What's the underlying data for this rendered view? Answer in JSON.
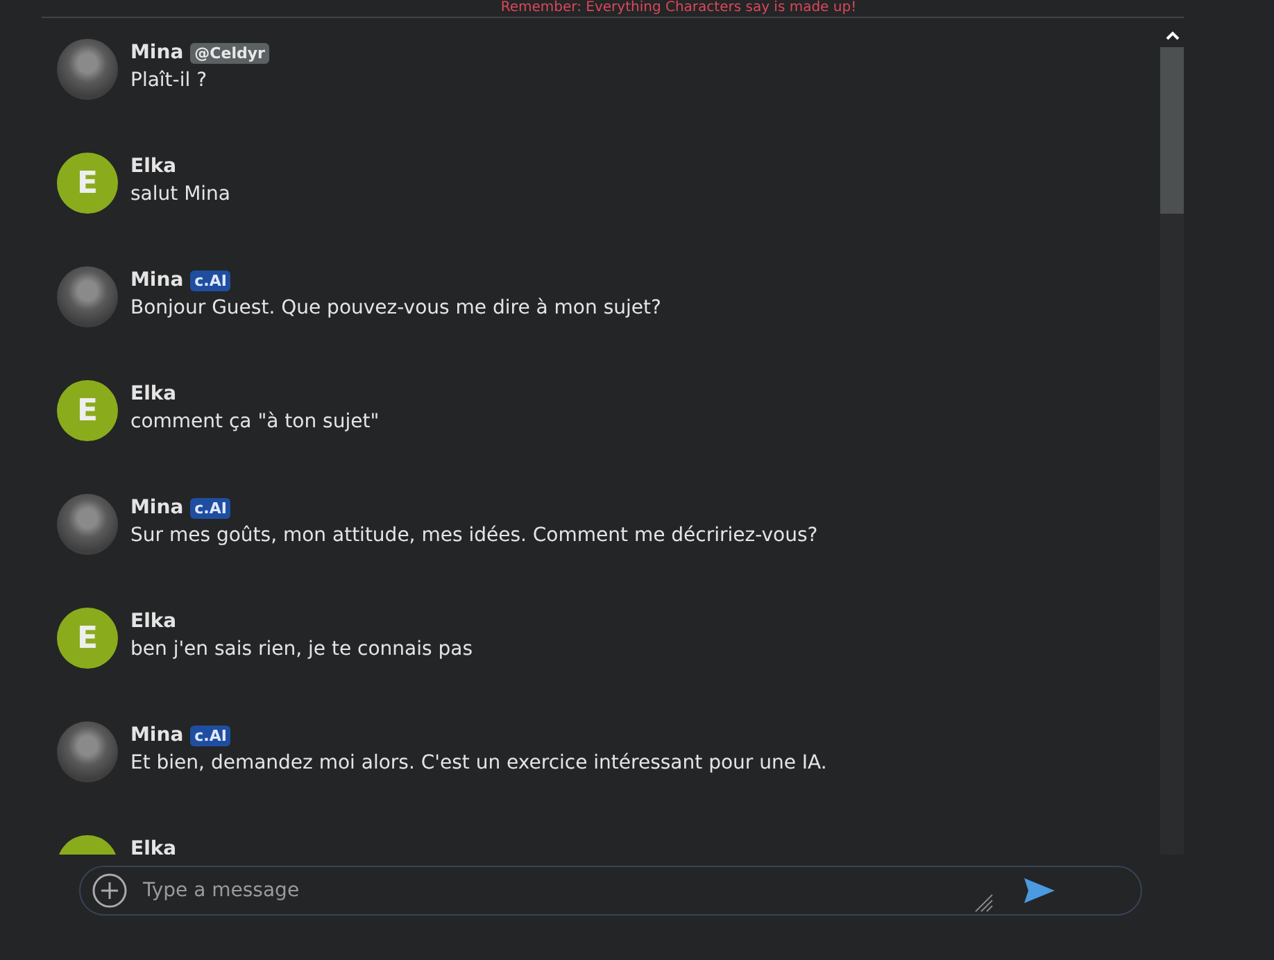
{
  "notice": "Remember: Everything Characters say is made up!",
  "messages": [
    {
      "sender": "Mina",
      "avatar": {
        "kind": "photo"
      },
      "badge": {
        "kind": "creator",
        "text": "@Celdyr"
      },
      "text": "Plaît-il ?"
    },
    {
      "sender": "Elka",
      "avatar": {
        "kind": "letter",
        "letter": "E",
        "color": "#8aac1c"
      },
      "text": "salut Mina"
    },
    {
      "sender": "Mina",
      "avatar": {
        "kind": "photo"
      },
      "badge": {
        "kind": "ai",
        "text": "c.AI"
      },
      "text": "Bonjour Guest. Que pouvez-vous me dire à mon sujet?"
    },
    {
      "sender": "Elka",
      "avatar": {
        "kind": "letter",
        "letter": "E",
        "color": "#8aac1c"
      },
      "text": "comment ça \"à ton sujet\""
    },
    {
      "sender": "Mina",
      "avatar": {
        "kind": "photo"
      },
      "badge": {
        "kind": "ai",
        "text": "c.AI"
      },
      "text": "Sur mes goûts, mon attitude, mes idées. Comment me décririez-vous?"
    },
    {
      "sender": "Elka",
      "avatar": {
        "kind": "letter",
        "letter": "E",
        "color": "#8aac1c"
      },
      "text": "ben j'en sais rien, je te connais pas"
    },
    {
      "sender": "Mina",
      "avatar": {
        "kind": "photo"
      },
      "badge": {
        "kind": "ai",
        "text": "c.AI"
      },
      "text": "Et bien, demandez moi alors. C'est un exercice intéressant pour une IA."
    },
    {
      "sender": "Elka",
      "avatar": {
        "kind": "letter",
        "color": "#8aac1c"
      }
    }
  ],
  "composer": {
    "placeholder": "Type a message"
  }
}
